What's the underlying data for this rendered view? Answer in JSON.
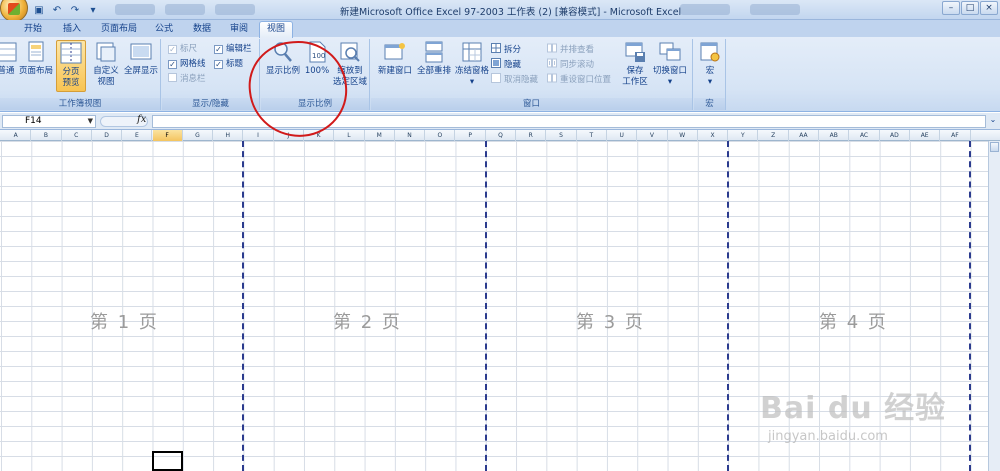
{
  "window": {
    "title": "新建Microsoft Office Excel 97-2003 工作表 (2)  [兼容模式] - Microsoft Excel",
    "controls": [
      "–",
      "□",
      "×"
    ]
  },
  "tabs": [
    {
      "label": "开始"
    },
    {
      "label": "插入"
    },
    {
      "label": "页面布局"
    },
    {
      "label": "公式"
    },
    {
      "label": "数据"
    },
    {
      "label": "审阅"
    },
    {
      "label": "视图",
      "active": true
    }
  ],
  "ribbon": {
    "workbook_views": {
      "label": "工作簿视图",
      "normal": "普通",
      "page_layout": "页面布局",
      "page_break_line1": "分页",
      "page_break_line2": "预览",
      "custom_line1": "自定义",
      "custom_line2": "视图",
      "fullscreen": "全屏显示"
    },
    "show_hide": {
      "label": "显示/隐藏",
      "ruler": "标尺",
      "gridlines": "网格线",
      "message_bar": "消息栏",
      "formula_bar": "编辑栏",
      "headings": "标题"
    },
    "zoom": {
      "label": "显示比例",
      "zoom_button": "显示比例",
      "hundred": "100%",
      "fit_line1": "缩放到",
      "fit_line2": "选定区域"
    },
    "window": {
      "label": "窗口",
      "new_window": "新建窗口",
      "arrange_all": "全部重排",
      "freeze": "冻结窗格",
      "split": "拆分",
      "hide": "隐藏",
      "unhide": "取消隐藏",
      "side_by_side": "并排查看",
      "sync_scroll": "同步滚动",
      "reset_position": "重设窗口位置",
      "save_workspace_line1": "保存",
      "save_workspace_line2": "工作区",
      "switch_windows": "切换窗口"
    },
    "macros": {
      "label": "宏",
      "button": "宏"
    }
  },
  "formula_bar": {
    "name_box": "F14",
    "fx": "fx",
    "content": ""
  },
  "columns": [
    "A",
    "B",
    "C",
    "D",
    "E",
    "F",
    "G",
    "H",
    "I",
    "J",
    "K",
    "L",
    "M",
    "N",
    "O",
    "P",
    "Q",
    "R",
    "S",
    "T",
    "U",
    "V",
    "W",
    "X",
    "Y",
    "Z",
    "AA",
    "AB",
    "AC",
    "AD",
    "AE",
    "AF"
  ],
  "selected_column": "F",
  "pages": [
    "第 1 页",
    "第 2 页",
    "第 3 页",
    "第 4 页"
  ],
  "watermark": {
    "main": "Bai du 经验",
    "sub": "jingyan.baidu.com"
  },
  "colors": {
    "annotation": "#d11a1a",
    "page_break": "#2b3b8e",
    "ribbon_text": "#15428b"
  }
}
